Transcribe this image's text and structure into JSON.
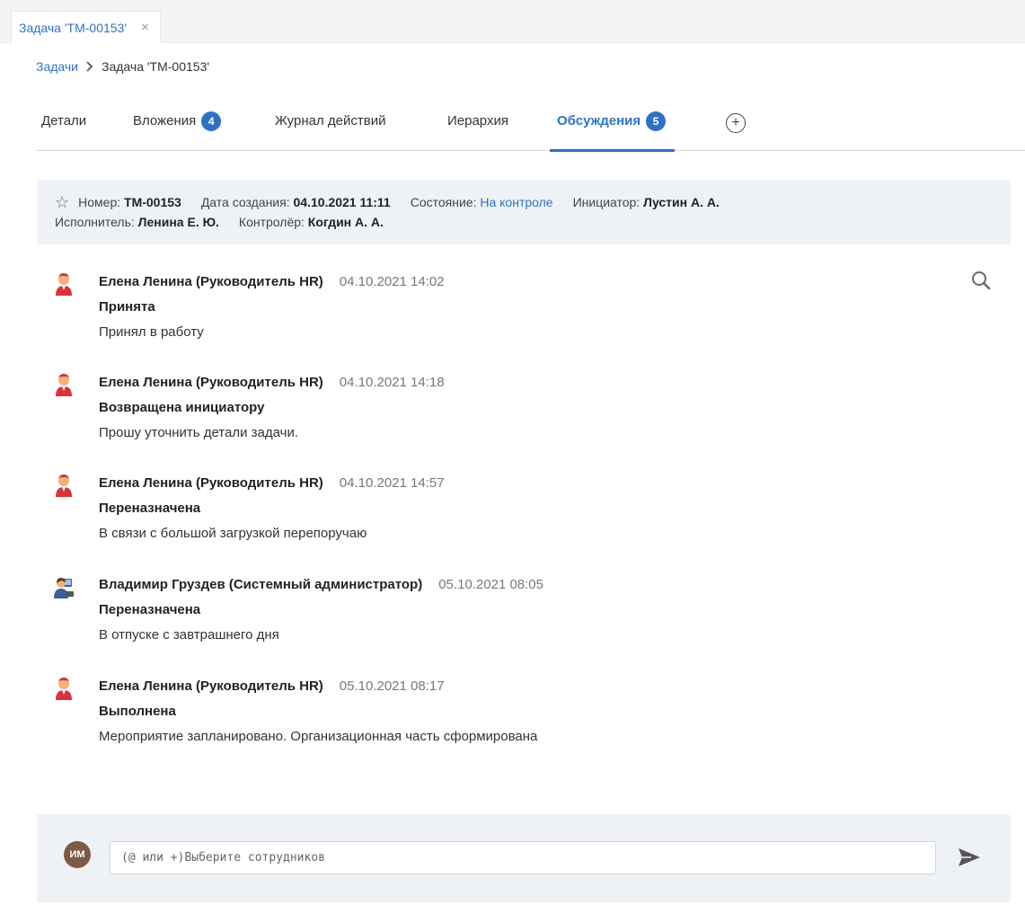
{
  "doc_tab": {
    "title": "Задача 'ТМ-00153'",
    "close": "×"
  },
  "breadcrumb": {
    "parent": "Задачи",
    "current": "Задача 'ТМ-00153'"
  },
  "tabs": [
    {
      "label": "Детали"
    },
    {
      "label": "Вложения",
      "badge": "4"
    },
    {
      "label": "Журнал действий"
    },
    {
      "label": "Иерархия"
    },
    {
      "label": "Обсуждения",
      "badge": "5",
      "active": true
    }
  ],
  "info": {
    "number_label": "Номер:",
    "number": "ТМ-00153",
    "created_label": "Дата создания:",
    "created": "04.10.2021 11:11",
    "state_label": "Состояние:",
    "state": "На контроле",
    "initiator_label": "Инициатор:",
    "initiator": "Лустин А. А.",
    "executor_label": "Исполнитель:",
    "executor": "Ленина Е. Ю.",
    "controller_label": "Контролёр:",
    "controller": "Когдин А. А."
  },
  "comments": [
    {
      "author": "Елена Ленина (Руководитель HR)",
      "date": "04.10.2021 14:02",
      "status": "Принята",
      "text": "Принял в работу",
      "avatar": "female-user-icon"
    },
    {
      "author": "Елена Ленина (Руководитель HR)",
      "date": "04.10.2021 14:18",
      "status": "Возвращена инициатору",
      "text": "Прошу уточнить детали задачи.",
      "avatar": "female-user-icon"
    },
    {
      "author": "Елена Ленина (Руководитель HR)",
      "date": "04.10.2021 14:57",
      "status": "Переназначена",
      "text": "В связи с большой загрузкой перепоручаю",
      "avatar": "female-user-icon"
    },
    {
      "author": "Владимир Груздев (Системный администратор)",
      "date": "05.10.2021 08:05",
      "status": "Переназначена",
      "text": "В отпуске с завтрашнего дня",
      "avatar": "admin-user-icon"
    },
    {
      "author": "Елена Ленина (Руководитель HR)",
      "date": "05.10.2021 08:17",
      "status": "Выполнена",
      "text": "Мероприятие запланировано. Организационная часть сформирована",
      "avatar": "female-user-icon"
    }
  ],
  "composer": {
    "avatar_initials": "ИМ",
    "placeholder": "(@ или +)Выберите сотрудников"
  },
  "colors": {
    "accent": "#2f72c4",
    "panel": "#eef1f5",
    "avatar_red": "#d8323a",
    "avatar_skin": "#f2b27a"
  }
}
